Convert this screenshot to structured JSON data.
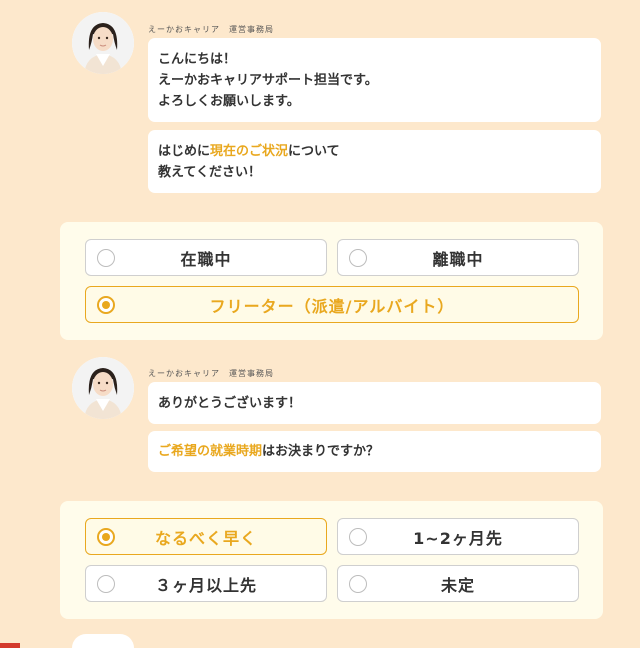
{
  "sender_name": "えーかおキャリア　運営事務局",
  "message1": {
    "lines": [
      "こんにちは！",
      "えーかおキャリアサポート担当です。",
      "よろしくお願いします。"
    ]
  },
  "message2": {
    "prefix": "はじめに",
    "highlight": "現在のご状況",
    "suffix": "について",
    "line2": "教えてください！"
  },
  "status_options": [
    {
      "label": "在職中",
      "selected": false
    },
    {
      "label": "離職中",
      "selected": false
    },
    {
      "label": "フリーター（派遣/アルバイト）",
      "selected": true
    }
  ],
  "message3": {
    "text": "ありがとうございます！"
  },
  "message4": {
    "highlight": "ご希望の就業時期",
    "suffix": "はお決まりですか？"
  },
  "timing_options": [
    {
      "label": "なるべく早く",
      "selected": true
    },
    {
      "label": "1~2ヶ月先",
      "selected": false
    },
    {
      "label": "３ヶ月以上先",
      "selected": false
    },
    {
      "label": "未定",
      "selected": false
    }
  ],
  "colors": {
    "background": "#FDE8CC",
    "accent": "#E9A81F",
    "panel": "#FFFCEB",
    "text": "#333333"
  },
  "icons": {
    "avatar": "operator-avatar-icon",
    "radio_off": "radio-unchecked-icon",
    "radio_on": "radio-checked-icon"
  }
}
